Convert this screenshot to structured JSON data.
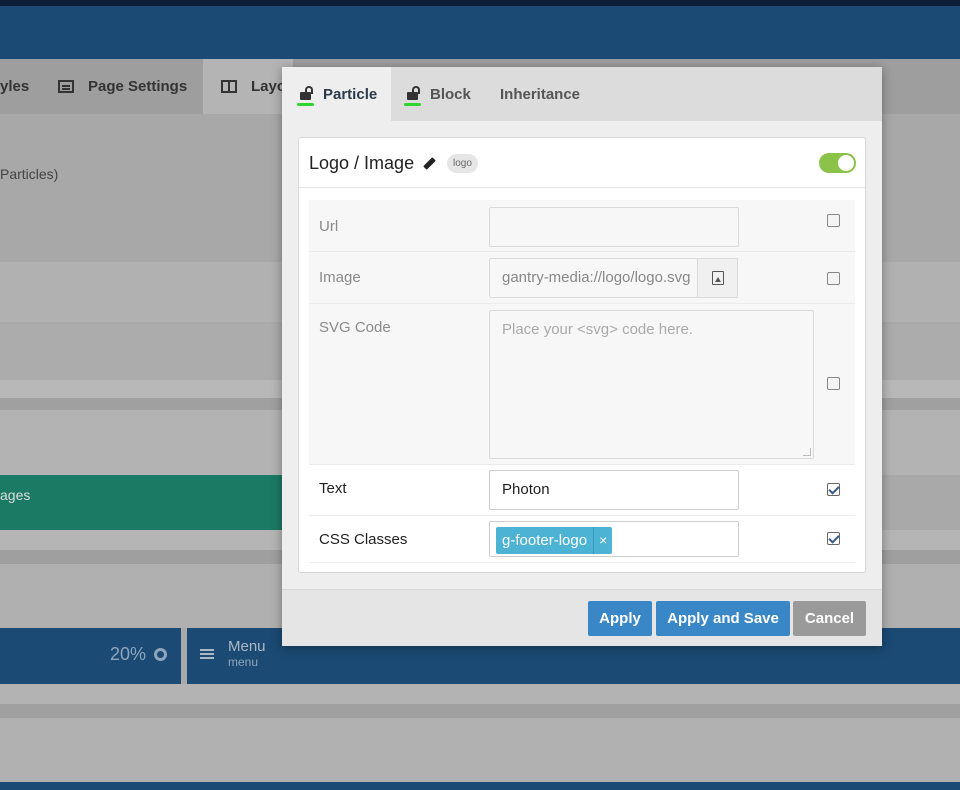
{
  "background": {
    "tabs": [
      {
        "label": "yles"
      },
      {
        "label": "Page Settings"
      },
      {
        "label": "Layo"
      }
    ],
    "particles_text": "Particles)",
    "section_label": "ages",
    "width_percent": "20%",
    "menu_title": "Menu",
    "menu_subtitle": "menu"
  },
  "modal": {
    "tabs": [
      {
        "label": "Particle",
        "active": true,
        "locked": false
      },
      {
        "label": "Block",
        "active": false,
        "locked": false
      },
      {
        "label": "Inheritance",
        "active": false
      }
    ],
    "card": {
      "title": "Logo / Image",
      "badge": "logo",
      "enabled": true
    },
    "fields": {
      "url": {
        "label": "Url",
        "value": "",
        "override": false
      },
      "image": {
        "label": "Image",
        "value": "gantry-media://logo/logo.svg",
        "override": false
      },
      "svg": {
        "label": "SVG Code",
        "placeholder": "Place your <svg> code here.",
        "override": false
      },
      "text": {
        "label": "Text",
        "value": "Photon",
        "override": true
      },
      "css": {
        "label": "CSS Classes",
        "tags": [
          "g-footer-logo"
        ],
        "tag_remove": "×",
        "override": true
      }
    },
    "buttons": {
      "apply": "Apply",
      "apply_save": "Apply and Save",
      "cancel": "Cancel"
    }
  }
}
